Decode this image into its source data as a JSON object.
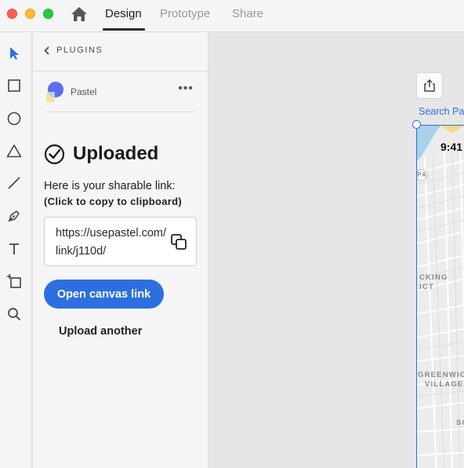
{
  "titlebar": {
    "tabs": [
      {
        "label": "Design",
        "active": true
      },
      {
        "label": "Prototype",
        "active": false
      },
      {
        "label": "Share",
        "active": false
      }
    ]
  },
  "toolbar": {
    "tools": [
      "select-tool",
      "rectangle-tool",
      "ellipse-tool",
      "polygon-tool",
      "line-tool",
      "pen-tool",
      "text-tool",
      "artboard-tool",
      "zoom-tool"
    ]
  },
  "panel": {
    "back_label": "PLUGINS",
    "plugin_name": "Pastel",
    "more_label": "•••",
    "status_title": "Uploaded",
    "share_text": "Here is your sharable link:",
    "share_hint": "(Click to copy to clipboard)",
    "link": "https://usepastel.com/link/j110d/",
    "open_button": "Open canvas link",
    "upload_another": "Upload another"
  },
  "canvas": {
    "artboard_label": "Search Pa",
    "status_time": "9:41",
    "map_labels": {
      "pa": "PA",
      "packing_1": "CKING",
      "packing_2": "ICT",
      "greenwich_1": "GREENWIC",
      "greenwich_2": "VILLAGE",
      "so": "SO"
    }
  },
  "colors": {
    "accent": "#2d6fe0",
    "panel_bg": "#f5f5f5",
    "canvas_bg": "#e6e6e6"
  }
}
